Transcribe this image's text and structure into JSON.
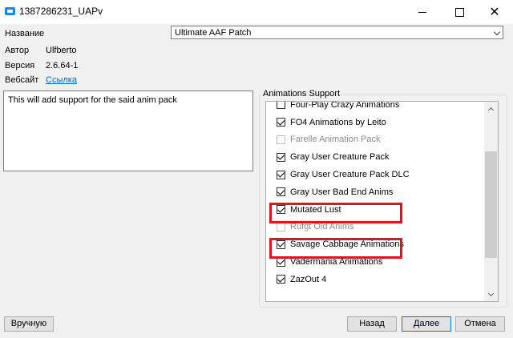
{
  "window": {
    "title": "1387286231_UAPv",
    "minimize_glyph": "—",
    "close_glyph": "✕"
  },
  "info": {
    "name_label": "Название",
    "name_value": "Ultimate AAF Patch",
    "author_label": "Автор",
    "author_value": "Ulfberto",
    "version_label": "Версия",
    "version_value": "2.6.64-1",
    "website_label": "Вебсайт",
    "website_link": "Ссылка"
  },
  "description": "This will add support for the said anim pack",
  "group": {
    "label": "Animations Support",
    "items": [
      {
        "label": "Four-Play Crazy Animations",
        "checked": false,
        "enabled": true
      },
      {
        "label": "FO4 Animations by Leito",
        "checked": true,
        "enabled": true
      },
      {
        "label": "Farelle Animation Pack",
        "checked": false,
        "enabled": false
      },
      {
        "label": "Gray User Creature Pack",
        "checked": true,
        "enabled": true
      },
      {
        "label": "Gray User Creature Pack DLC",
        "checked": true,
        "enabled": true
      },
      {
        "label": "Gray User Bad End Anims",
        "checked": true,
        "enabled": true
      },
      {
        "label": "Mutated Lust",
        "checked": true,
        "enabled": true
      },
      {
        "label": "Rufgt Old Anims",
        "checked": false,
        "enabled": false
      },
      {
        "label": "Savage Cabbage Animations",
        "checked": true,
        "enabled": true
      },
      {
        "label": "Vadermania Animations",
        "checked": true,
        "enabled": true
      },
      {
        "label": "ZazOut 4",
        "checked": true,
        "enabled": true
      }
    ],
    "scroll_position": 0.55,
    "scroll_visible_fraction": 0.62
  },
  "buttons": {
    "manual": "Вручную",
    "back": "Назад",
    "next": "Далее",
    "cancel": "Отмена"
  },
  "colors": {
    "highlight": "#e0131f",
    "link": "#0066cc"
  }
}
